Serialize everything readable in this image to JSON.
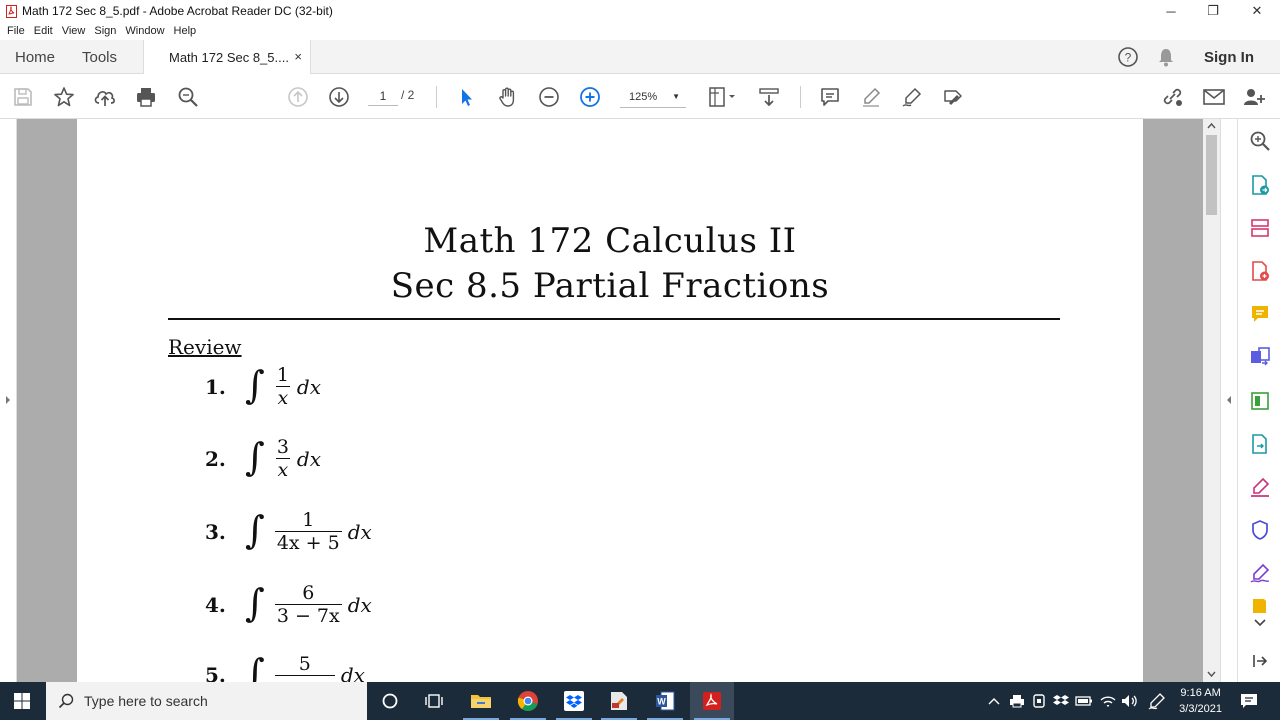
{
  "window": {
    "title": "Math 172 Sec 8_5.pdf - Adobe Acrobat Reader DC (32-bit)",
    "minimize": "─",
    "restore": "❐",
    "close": "✕"
  },
  "menu": [
    "File",
    "Edit",
    "View",
    "Sign",
    "Window",
    "Help"
  ],
  "tabs": {
    "home": "Home",
    "tools": "Tools",
    "document": "Math 172 Sec 8_5....",
    "close": "×",
    "signin": "Sign In"
  },
  "toolbar": {
    "page_current": "1",
    "page_total": "/ 2",
    "zoom": "125%"
  },
  "document": {
    "title_line1": "Math 172 Calculus II",
    "title_line2": "Sec 8.5 Partial Fractions",
    "section": "Review",
    "problems": [
      {
        "num": "1.",
        "numerator": "1",
        "denominator": "x",
        "diff": "dx"
      },
      {
        "num": "2.",
        "numerator": "3",
        "denominator": "x",
        "diff": "dx"
      },
      {
        "num": "3.",
        "numerator": "1",
        "denominator": "4x + 5",
        "diff": "dx"
      },
      {
        "num": "4.",
        "numerator": "6",
        "denominator": "3 − 7x",
        "diff": "dx"
      },
      {
        "num": "5.",
        "numerator": "5",
        "denominator": "",
        "diff": "dx"
      }
    ]
  },
  "taskbar": {
    "search_placeholder": "Type here to search",
    "time": "9:16 AM",
    "date": "3/3/2021"
  },
  "colors": {
    "acrobat_red": "#d4201c",
    "blue_accent": "#1473e6",
    "taskbar": "#1c2b3a"
  }
}
